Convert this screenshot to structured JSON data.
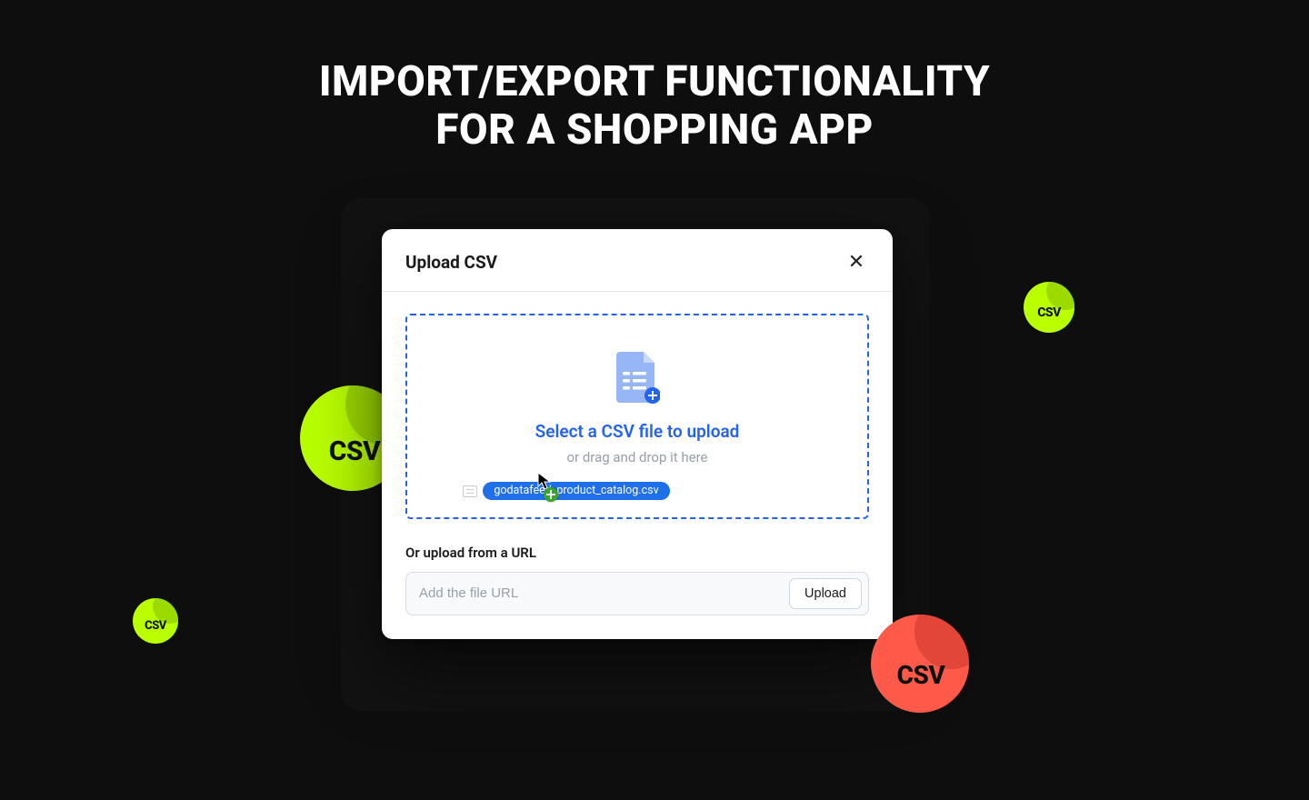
{
  "hero": {
    "line1": "IMPORT/EXPORT FUNCTIONALITY",
    "line2": "FOR A SHOPPING APP"
  },
  "modal": {
    "title": "Upload CSV",
    "dropzone": {
      "primary": "Select a CSV file to upload",
      "secondary": "or drag and drop it here",
      "dragging_filename": "godatafeed_product_catalog.csv"
    },
    "url": {
      "label": "Or upload from a URL",
      "placeholder": "Add the file URL",
      "button": "Upload"
    }
  },
  "stickers": {
    "csv_label": "CSV"
  }
}
